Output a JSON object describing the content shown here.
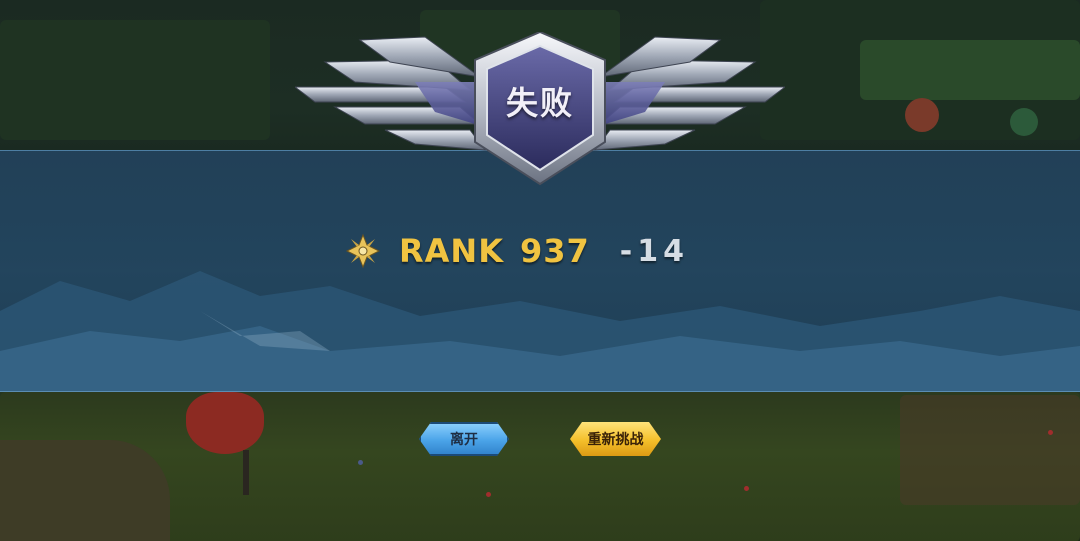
{
  "result": {
    "title": "失败"
  },
  "rank": {
    "label": "RANK",
    "value": "937",
    "delta": "-14"
  },
  "buttons": {
    "leave_label": "离开",
    "retry_label": "重新挑战"
  },
  "colors": {
    "band": "#244864",
    "rank_gold": "#f0c341",
    "delta_grey": "#d6dde4",
    "leave_button": "#4aa3e8",
    "retry_button": "#f4bf2a",
    "emblem_core": "#3d3d72"
  },
  "icons": {
    "emblem": "winged-shield-emblem",
    "rank": "rank-cross-icon"
  }
}
